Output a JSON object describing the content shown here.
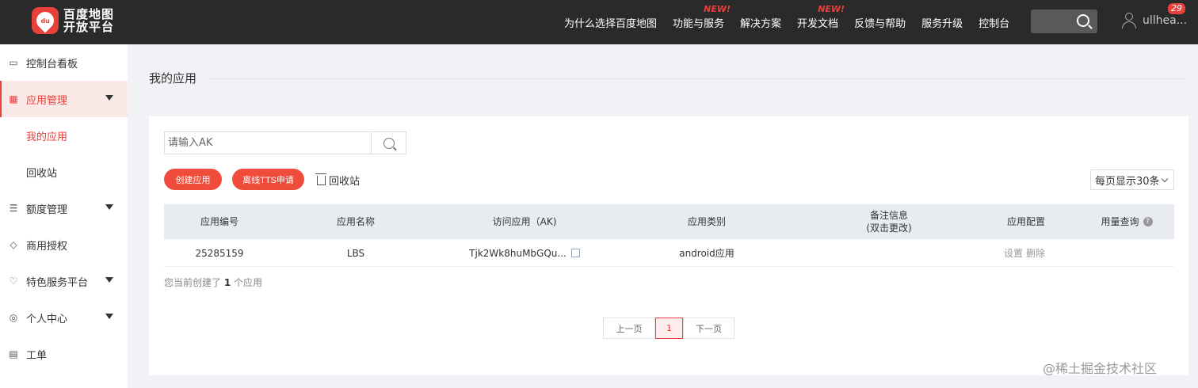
{
  "brand": {
    "name": "百度地图开放平台",
    "line1": "百度地图",
    "line2": "开放平台",
    "mark": "du"
  },
  "nav": [
    {
      "label": "为什么选择百度地图",
      "new": ""
    },
    {
      "label": "功能与服务",
      "new": "NEW!"
    },
    {
      "label": "解决方案",
      "new": ""
    },
    {
      "label": "开发文档",
      "new": "NEW!"
    },
    {
      "label": "反馈与帮助",
      "new": ""
    },
    {
      "label": "服务升级",
      "new": ""
    },
    {
      "label": "控制台",
      "new": ""
    }
  ],
  "user": {
    "name": "ullhea...",
    "badge": "29"
  },
  "sidebar": {
    "items": [
      {
        "label": "控制台看板",
        "icon": "dashboard-icon"
      },
      {
        "label": "应用管理",
        "icon": "grid-icon"
      },
      {
        "label": "额度管理",
        "icon": "sliders-icon"
      },
      {
        "label": "商用授权",
        "icon": "shield-icon"
      },
      {
        "label": "特色服务平台",
        "icon": "heart-icon"
      },
      {
        "label": "个人中心",
        "icon": "user-circle-icon"
      },
      {
        "label": "工单",
        "icon": "clipboard-icon"
      }
    ],
    "subitems": [
      {
        "label": "我的应用"
      },
      {
        "label": "回收站"
      }
    ]
  },
  "page": {
    "title": "我的应用"
  },
  "search": {
    "placeholder": "请输入AK"
  },
  "actions": {
    "create": "创建应用",
    "tts": "离线TTS申请",
    "recycle": "回收站"
  },
  "perpage": {
    "value": "每页显示30条"
  },
  "table": {
    "headers": [
      "应用编号",
      "应用名称",
      "访问应用（AK)",
      "应用类别",
      "备注信息\n(双击更改)",
      "应用配置",
      "用量查询"
    ],
    "rows": [
      {
        "id": "25285159",
        "name": "LBS",
        "ak": "Tjk2Wk8huMbGQu...",
        "category": "android应用",
        "note": "",
        "settings": "设置",
        "delete": "删除"
      }
    ]
  },
  "summary": {
    "prefix": "您当前创建了",
    "count": "1",
    "suffix": "个应用"
  },
  "pager": {
    "prev": "上一页",
    "current": "1",
    "next": "下一页"
  },
  "watermark": "@稀土掘金技术社区",
  "colors": {
    "accent": "#e8413a",
    "topbar": "#2a2a2a",
    "tablehead": "#e8ecf1"
  }
}
